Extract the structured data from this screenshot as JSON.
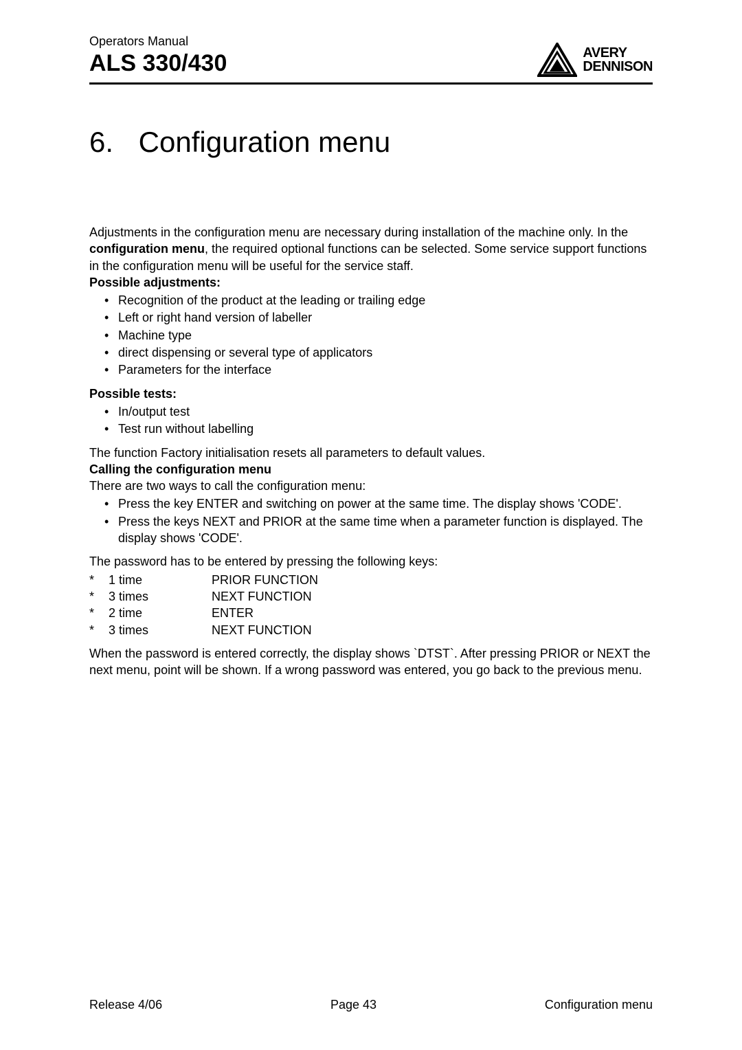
{
  "header": {
    "manual_type": "Operators Manual",
    "product_model": "ALS 330/430",
    "brand_line1": "AVERY",
    "brand_line2": "DENNISON"
  },
  "title": {
    "number": "6.",
    "text": "Configuration menu"
  },
  "intro": {
    "part1": "Adjustments in the configuration menu are necessary during installation of the machine only. In the ",
    "bold": "configuration menu",
    "part2": ", the required optional functions can be selected. Some service support functions in the configuration menu will be useful for the service staff."
  },
  "adjustments": {
    "heading": "Possible adjustments:",
    "items": [
      "Recognition of the product at the leading or trailing edge",
      "Left or right hand version of labeller",
      "Machine type",
      "direct dispensing or several type of applicators",
      "Parameters for the interface"
    ]
  },
  "tests": {
    "heading": "Possible tests:",
    "items": [
      "In/output test",
      "Test run without labelling"
    ]
  },
  "factory_reset": "The function Factory initialisation resets all parameters to default values.",
  "calling": {
    "heading": "Calling the configuration menu",
    "intro": "There are two ways to call the configuration menu:",
    "items": [
      "Press the key ENTER and switching on power at the same time. The display shows 'CODE'.",
      "Press the keys NEXT and PRIOR at the same time when a parameter function is displayed. The display shows 'CODE'."
    ]
  },
  "password": {
    "intro": "The password has to be entered by pressing the following keys:",
    "rows": [
      {
        "star": "*",
        "times": "1 time",
        "key": "PRIOR FUNCTION"
      },
      {
        "star": "*",
        "times": "3 times",
        "key": "NEXT FUNCTION"
      },
      {
        "star": "*",
        "times": "2 time",
        "key": "ENTER"
      },
      {
        "star": "*",
        "times": "3 times",
        "key": "NEXT FUNCTION"
      }
    ]
  },
  "closing": "When the password is entered correctly, the display shows `DTST`. After pressing PRIOR or NEXT the next menu, point will be shown. If a wrong password was entered, you go back to the previous menu.",
  "footer": {
    "left": "Release 4/06",
    "center": "Page 43",
    "right": "Configuration menu"
  }
}
